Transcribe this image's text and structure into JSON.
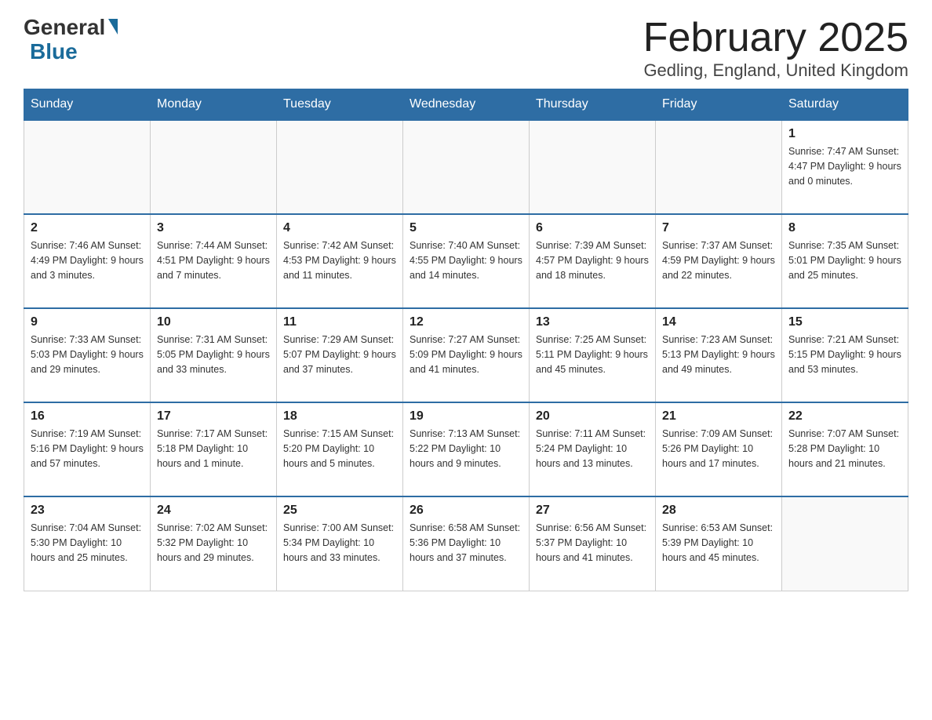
{
  "logo": {
    "general": "General",
    "blue": "Blue"
  },
  "title": "February 2025",
  "subtitle": "Gedling, England, United Kingdom",
  "days_header": [
    "Sunday",
    "Monday",
    "Tuesday",
    "Wednesday",
    "Thursday",
    "Friday",
    "Saturday"
  ],
  "weeks": [
    [
      {
        "day": "",
        "info": ""
      },
      {
        "day": "",
        "info": ""
      },
      {
        "day": "",
        "info": ""
      },
      {
        "day": "",
        "info": ""
      },
      {
        "day": "",
        "info": ""
      },
      {
        "day": "",
        "info": ""
      },
      {
        "day": "1",
        "info": "Sunrise: 7:47 AM\nSunset: 4:47 PM\nDaylight: 9 hours\nand 0 minutes."
      }
    ],
    [
      {
        "day": "2",
        "info": "Sunrise: 7:46 AM\nSunset: 4:49 PM\nDaylight: 9 hours\nand 3 minutes."
      },
      {
        "day": "3",
        "info": "Sunrise: 7:44 AM\nSunset: 4:51 PM\nDaylight: 9 hours\nand 7 minutes."
      },
      {
        "day": "4",
        "info": "Sunrise: 7:42 AM\nSunset: 4:53 PM\nDaylight: 9 hours\nand 11 minutes."
      },
      {
        "day": "5",
        "info": "Sunrise: 7:40 AM\nSunset: 4:55 PM\nDaylight: 9 hours\nand 14 minutes."
      },
      {
        "day": "6",
        "info": "Sunrise: 7:39 AM\nSunset: 4:57 PM\nDaylight: 9 hours\nand 18 minutes."
      },
      {
        "day": "7",
        "info": "Sunrise: 7:37 AM\nSunset: 4:59 PM\nDaylight: 9 hours\nand 22 minutes."
      },
      {
        "day": "8",
        "info": "Sunrise: 7:35 AM\nSunset: 5:01 PM\nDaylight: 9 hours\nand 25 minutes."
      }
    ],
    [
      {
        "day": "9",
        "info": "Sunrise: 7:33 AM\nSunset: 5:03 PM\nDaylight: 9 hours\nand 29 minutes."
      },
      {
        "day": "10",
        "info": "Sunrise: 7:31 AM\nSunset: 5:05 PM\nDaylight: 9 hours\nand 33 minutes."
      },
      {
        "day": "11",
        "info": "Sunrise: 7:29 AM\nSunset: 5:07 PM\nDaylight: 9 hours\nand 37 minutes."
      },
      {
        "day": "12",
        "info": "Sunrise: 7:27 AM\nSunset: 5:09 PM\nDaylight: 9 hours\nand 41 minutes."
      },
      {
        "day": "13",
        "info": "Sunrise: 7:25 AM\nSunset: 5:11 PM\nDaylight: 9 hours\nand 45 minutes."
      },
      {
        "day": "14",
        "info": "Sunrise: 7:23 AM\nSunset: 5:13 PM\nDaylight: 9 hours\nand 49 minutes."
      },
      {
        "day": "15",
        "info": "Sunrise: 7:21 AM\nSunset: 5:15 PM\nDaylight: 9 hours\nand 53 minutes."
      }
    ],
    [
      {
        "day": "16",
        "info": "Sunrise: 7:19 AM\nSunset: 5:16 PM\nDaylight: 9 hours\nand 57 minutes."
      },
      {
        "day": "17",
        "info": "Sunrise: 7:17 AM\nSunset: 5:18 PM\nDaylight: 10 hours\nand 1 minute."
      },
      {
        "day": "18",
        "info": "Sunrise: 7:15 AM\nSunset: 5:20 PM\nDaylight: 10 hours\nand 5 minutes."
      },
      {
        "day": "19",
        "info": "Sunrise: 7:13 AM\nSunset: 5:22 PM\nDaylight: 10 hours\nand 9 minutes."
      },
      {
        "day": "20",
        "info": "Sunrise: 7:11 AM\nSunset: 5:24 PM\nDaylight: 10 hours\nand 13 minutes."
      },
      {
        "day": "21",
        "info": "Sunrise: 7:09 AM\nSunset: 5:26 PM\nDaylight: 10 hours\nand 17 minutes."
      },
      {
        "day": "22",
        "info": "Sunrise: 7:07 AM\nSunset: 5:28 PM\nDaylight: 10 hours\nand 21 minutes."
      }
    ],
    [
      {
        "day": "23",
        "info": "Sunrise: 7:04 AM\nSunset: 5:30 PM\nDaylight: 10 hours\nand 25 minutes."
      },
      {
        "day": "24",
        "info": "Sunrise: 7:02 AM\nSunset: 5:32 PM\nDaylight: 10 hours\nand 29 minutes."
      },
      {
        "day": "25",
        "info": "Sunrise: 7:00 AM\nSunset: 5:34 PM\nDaylight: 10 hours\nand 33 minutes."
      },
      {
        "day": "26",
        "info": "Sunrise: 6:58 AM\nSunset: 5:36 PM\nDaylight: 10 hours\nand 37 minutes."
      },
      {
        "day": "27",
        "info": "Sunrise: 6:56 AM\nSunset: 5:37 PM\nDaylight: 10 hours\nand 41 minutes."
      },
      {
        "day": "28",
        "info": "Sunrise: 6:53 AM\nSunset: 5:39 PM\nDaylight: 10 hours\nand 45 minutes."
      },
      {
        "day": "",
        "info": ""
      }
    ]
  ]
}
